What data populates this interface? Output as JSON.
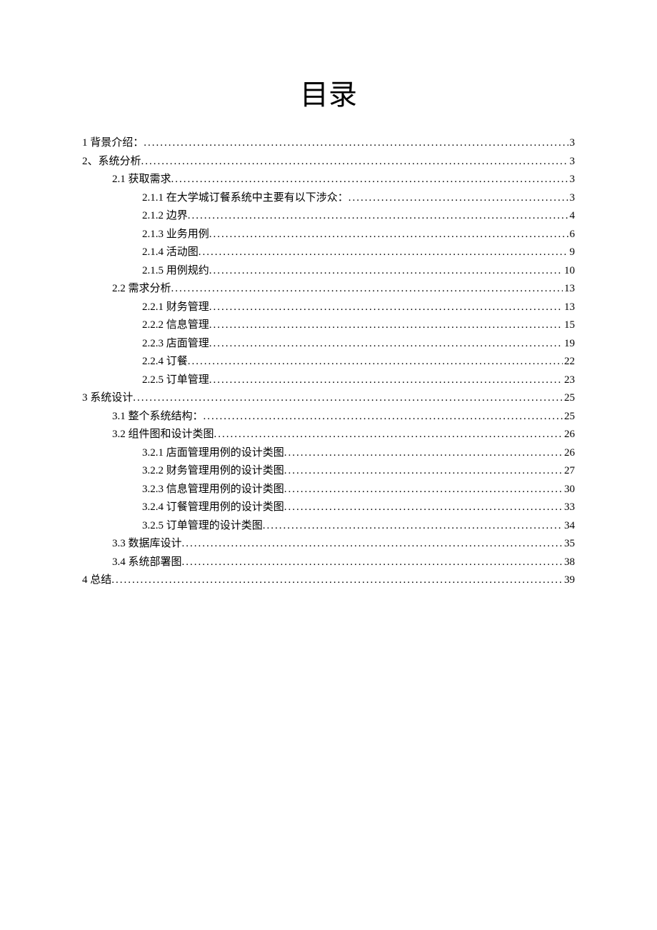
{
  "title": "目录",
  "toc": [
    {
      "level": 1,
      "label": "1 背景介绍：",
      "page": "3"
    },
    {
      "level": 1,
      "label": "2、系统分析",
      "page": "3"
    },
    {
      "level": 2,
      "label": "2.1  获取需求",
      "page": "3"
    },
    {
      "level": 3,
      "label": "2.1.1 在大学城订餐系统中主要有以下涉众：",
      "page": "3"
    },
    {
      "level": 3,
      "label": "2.1.2 边界",
      "page": "4"
    },
    {
      "level": 3,
      "label": "2.1.3 业务用例",
      "page": "6"
    },
    {
      "level": 3,
      "label": "2.1.4 活动图",
      "page": "9"
    },
    {
      "level": 3,
      "label": "2.1.5 用例规约",
      "page": "10"
    },
    {
      "level": 2,
      "label": "2.2 需求分析",
      "page": "13"
    },
    {
      "level": 3,
      "label": "2.2.1 财务管理",
      "page": "13"
    },
    {
      "level": 3,
      "label": "2.2.2 信息管理",
      "page": "15"
    },
    {
      "level": 3,
      "label": "2.2.3 店面管理",
      "page": "19"
    },
    {
      "level": 3,
      "label": "2.2.4 订餐",
      "page": "22"
    },
    {
      "level": 3,
      "label": "2.2.5  订单管理",
      "page": "23"
    },
    {
      "level": 1,
      "label": "3  系统设计",
      "page": "25"
    },
    {
      "level": 2,
      "label": "3.1 整个系统结构：",
      "page": "25"
    },
    {
      "level": 2,
      "label": "3.2 组件图和设计类图",
      "page": "26"
    },
    {
      "level": 3,
      "label": "3.2.1 店面管理用例的设计类图",
      "page": "26"
    },
    {
      "level": 3,
      "label": "3.2.2 财务管理用例的设计类图",
      "page": "27"
    },
    {
      "level": 3,
      "label": "3.2.3 信息管理用例的设计类图",
      "page": "30"
    },
    {
      "level": 3,
      "label": "3.2.4 订餐管理用例的设计类图",
      "page": "33"
    },
    {
      "level": 3,
      "label": "3.2.5 订单管理的设计类图",
      "page": "34"
    },
    {
      "level": 2,
      "label": "3.3 数据库设计",
      "page": "35"
    },
    {
      "level": 2,
      "label": "3.4 系统部署图",
      "page": "38"
    },
    {
      "level": 1,
      "label": "4 总结",
      "page": "39"
    }
  ]
}
